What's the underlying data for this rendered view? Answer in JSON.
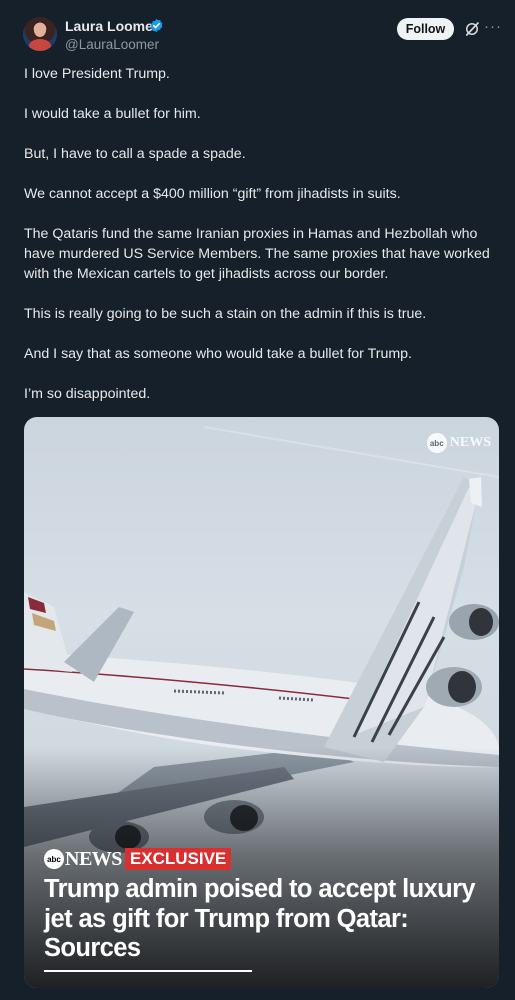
{
  "author": {
    "name": "Laura Loomer",
    "handle": "@LauraLoomer",
    "verified": true
  },
  "actions": {
    "follow_label": "Follow",
    "grok_icon": "grok-icon",
    "more_label": "···"
  },
  "post": {
    "paragraphs": [
      "I love President Trump.",
      "I would take a bullet for him.",
      "But, I have to call a spade a spade.",
      "We cannot accept a $400 million “gift” from jihadists in suits.",
      "The Qataris fund the same Iranian proxies in Hamas and Hezbollah who have murdered US Service Members. The same proxies that have worked with the Mexican cartels to get jihadists across our border.",
      "This is really going to be such a stain on the admin if this is true.",
      "And I say that as someone who would take a bullet for Trump.",
      "I’m so disappointed."
    ]
  },
  "media": {
    "watermark_logo": "abc",
    "watermark_text": "NEWS",
    "badge_logo": "abc",
    "badge_news": "NEWS",
    "badge_exclusive": "EXCLUSIVE",
    "headline": "Trump admin poised to accept luxury jet as gift for Trump from Qatar: Sources"
  },
  "colors": {
    "background": "#15202b",
    "text": "#e7e9ea",
    "secondary_text": "#8b98a5",
    "verified_blue": "#1d9bf0",
    "exclusive_red": "#d92f2f"
  }
}
